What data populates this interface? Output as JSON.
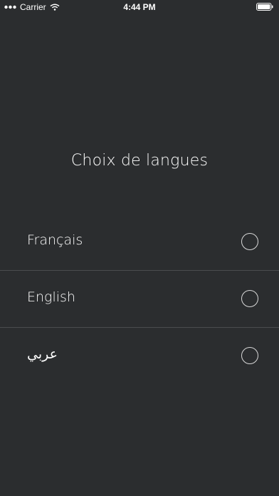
{
  "status_bar": {
    "carrier": "Carrier",
    "time": "4:44 PM"
  },
  "screen": {
    "title": "Choix de langues"
  },
  "languages": [
    {
      "label": "Français",
      "selected": false
    },
    {
      "label": "English",
      "selected": false
    },
    {
      "label": "عربي",
      "selected": false
    }
  ],
  "colors": {
    "background": "#2b2d2f",
    "text": "#ffffff",
    "divider": "#4a4c4e",
    "radio_border": "#d9d9d9"
  }
}
